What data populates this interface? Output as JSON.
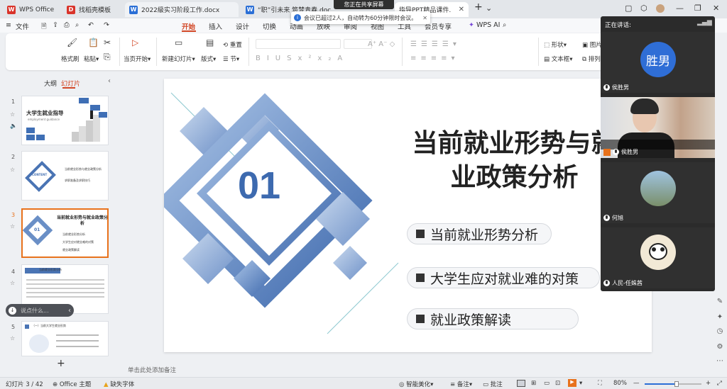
{
  "tabs": [
    {
      "label": "WPS Office",
      "icon": "wps-logo",
      "color": "#d9342b"
    },
    {
      "label": "找稻壳模板",
      "icon": "docer-icon",
      "color": "#d9342b"
    },
    {
      "label": "2022級实习阶段工作.docx",
      "icon": "word-doc-icon",
      "color": "#2b6fd6"
    },
    {
      "label": "“职”引未来 筑梦青春.doc",
      "icon": "word-doc-icon",
      "color": "#2b6fd6"
    },
    {
      "label": "指导PPT精品课件.",
      "icon": "ppt-icon",
      "color": "#d24726"
    }
  ],
  "share_banner": "您正在共享屏幕",
  "notice": "会议已超过2人，自动转为60分钟限时会议。",
  "menu": {
    "file": "文件",
    "tabs": [
      "开始",
      "插入",
      "设计",
      "切换",
      "动画",
      "放映",
      "审阅",
      "视图",
      "工具",
      "会员专享"
    ],
    "active": "开始",
    "ai": "WPS AI"
  },
  "ribbon": {
    "format_painter": "格式刷",
    "paste": "粘贴",
    "play": "当页开始",
    "new_slide": "新建幻灯片",
    "layout": "版式",
    "section": "节",
    "reset": "重置",
    "shape": "形状",
    "picture": "图片",
    "textbox": "文本框",
    "arrange": "排列"
  },
  "panel": {
    "outline_tab": "大纲",
    "slides_tab": "幻灯片",
    "search_placeholder": "说点什么..."
  },
  "thumbs": [
    {
      "num": "1",
      "title": "大学生就业指导",
      "subtitle": "employment guidance"
    },
    {
      "num": "2",
      "title": "CONTENT",
      "items": [
        "当前就业形势与就业政策分析",
        "求职准备及求职技巧"
      ]
    },
    {
      "num": "3",
      "title": "当前就业形势与就业政策分析",
      "items": [
        "当前就业形势分析",
        "大学生应对就业难的对策",
        "就业政策解读"
      ]
    },
    {
      "num": "4",
      "title": "当前就业形势分析"
    },
    {
      "num": "5",
      "title": "（一）当前大学生就业形势"
    }
  ],
  "slide": {
    "number": "01",
    "title_line1": "当前就业形势与就",
    "title_line2": "业政策分析",
    "bullets": [
      "当前就业形势分析",
      "大学生应对就业难的对策",
      "就业政策解读"
    ]
  },
  "notes_placeholder": "单击此处添加备注",
  "status": {
    "slide_counter": "幻灯片 3 / 42",
    "theme": "Office 主题",
    "missing_font": "缺失字体",
    "smart": "智能美化",
    "notes": "备注",
    "comments": "批注",
    "zoom": "80%"
  },
  "meeting": {
    "header": "正在讲话:",
    "avatar_text": "胜男",
    "participants": [
      "侯胜男",
      "侯胜男",
      "何旭",
      "人民-任姝茜"
    ]
  }
}
